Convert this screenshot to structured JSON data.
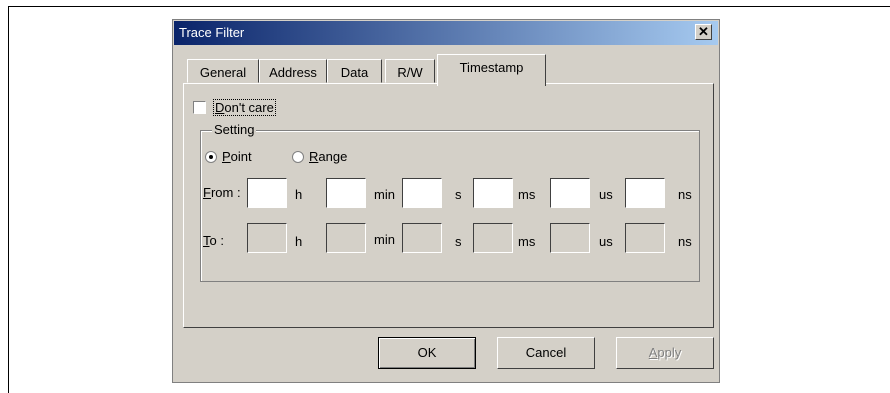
{
  "dialog": {
    "title": "Trace Filter",
    "close_symbol": "✕"
  },
  "tabs": [
    "General",
    "Address",
    "Data",
    "R/W",
    "Timestamp"
  ],
  "active_tab": "Timestamp",
  "dont_care": {
    "label_mnemonic": "D",
    "label_rest": "on't care",
    "checked": false
  },
  "setting": {
    "caption": "Setting",
    "point": {
      "mnemonic": "P",
      "rest": "oint",
      "selected": true
    },
    "range": {
      "mnemonic": "R",
      "rest": "ange",
      "selected": false
    }
  },
  "from_row": {
    "label_mnemonic": "F",
    "label_rest": "rom :",
    "fields": [
      {
        "value": "",
        "unit": "h"
      },
      {
        "value": "",
        "unit": "min"
      },
      {
        "value": "",
        "unit": "s"
      },
      {
        "value": "",
        "unit": "ms"
      },
      {
        "value": "",
        "unit": "us"
      },
      {
        "value": "",
        "unit": "ns"
      }
    ]
  },
  "to_row": {
    "label_mnemonic": "T",
    "label_rest": "o :",
    "fields": [
      {
        "value": "",
        "unit": "h"
      },
      {
        "value": "",
        "unit": "min"
      },
      {
        "value": "",
        "unit": "s"
      },
      {
        "value": "",
        "unit": "ms"
      },
      {
        "value": "",
        "unit": "us"
      },
      {
        "value": "",
        "unit": "ns"
      }
    ]
  },
  "buttons": {
    "ok": "OK",
    "cancel": "Cancel",
    "apply_mnemonic": "A",
    "apply_rest": "pply"
  },
  "colors": {
    "titlebar_start": "#0a246a",
    "titlebar_end": "#a6caf0",
    "face": "#d4d0c8"
  }
}
